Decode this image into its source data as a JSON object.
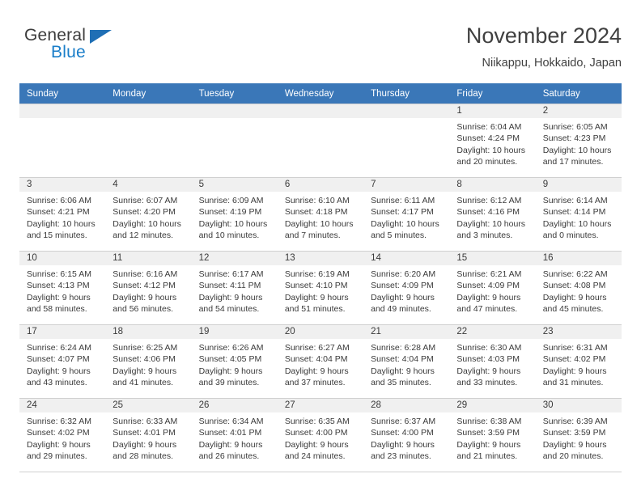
{
  "brand": {
    "name_part1": "General",
    "name_part2": "Blue",
    "triangle_color": "#1f6fb5",
    "blue_color": "#1a7ec9"
  },
  "header": {
    "month_title": "November 2024",
    "location": "Niikappu, Hokkaido, Japan"
  },
  "colors": {
    "header_blue": "#3a77b8",
    "daynum_band": "#f0f0f0",
    "cell_border": "#cfcfcf",
    "text": "#3a3a3a"
  },
  "weekdays": [
    "Sunday",
    "Monday",
    "Tuesday",
    "Wednesday",
    "Thursday",
    "Friday",
    "Saturday"
  ],
  "weeks": [
    [
      {
        "day": "",
        "sunrise": "",
        "sunset": "",
        "daylight": "",
        "blank": true
      },
      {
        "day": "",
        "sunrise": "",
        "sunset": "",
        "daylight": "",
        "blank": true
      },
      {
        "day": "",
        "sunrise": "",
        "sunset": "",
        "daylight": "",
        "blank": true
      },
      {
        "day": "",
        "sunrise": "",
        "sunset": "",
        "daylight": "",
        "blank": true
      },
      {
        "day": "",
        "sunrise": "",
        "sunset": "",
        "daylight": "",
        "blank": true
      },
      {
        "day": "1",
        "sunrise": "Sunrise: 6:04 AM",
        "sunset": "Sunset: 4:24 PM",
        "daylight": "Daylight: 10 hours and 20 minutes."
      },
      {
        "day": "2",
        "sunrise": "Sunrise: 6:05 AM",
        "sunset": "Sunset: 4:23 PM",
        "daylight": "Daylight: 10 hours and 17 minutes."
      }
    ],
    [
      {
        "day": "3",
        "sunrise": "Sunrise: 6:06 AM",
        "sunset": "Sunset: 4:21 PM",
        "daylight": "Daylight: 10 hours and 15 minutes."
      },
      {
        "day": "4",
        "sunrise": "Sunrise: 6:07 AM",
        "sunset": "Sunset: 4:20 PM",
        "daylight": "Daylight: 10 hours and 12 minutes."
      },
      {
        "day": "5",
        "sunrise": "Sunrise: 6:09 AM",
        "sunset": "Sunset: 4:19 PM",
        "daylight": "Daylight: 10 hours and 10 minutes."
      },
      {
        "day": "6",
        "sunrise": "Sunrise: 6:10 AM",
        "sunset": "Sunset: 4:18 PM",
        "daylight": "Daylight: 10 hours and 7 minutes."
      },
      {
        "day": "7",
        "sunrise": "Sunrise: 6:11 AM",
        "sunset": "Sunset: 4:17 PM",
        "daylight": "Daylight: 10 hours and 5 minutes."
      },
      {
        "day": "8",
        "sunrise": "Sunrise: 6:12 AM",
        "sunset": "Sunset: 4:16 PM",
        "daylight": "Daylight: 10 hours and 3 minutes."
      },
      {
        "day": "9",
        "sunrise": "Sunrise: 6:14 AM",
        "sunset": "Sunset: 4:14 PM",
        "daylight": "Daylight: 10 hours and 0 minutes."
      }
    ],
    [
      {
        "day": "10",
        "sunrise": "Sunrise: 6:15 AM",
        "sunset": "Sunset: 4:13 PM",
        "daylight": "Daylight: 9 hours and 58 minutes."
      },
      {
        "day": "11",
        "sunrise": "Sunrise: 6:16 AM",
        "sunset": "Sunset: 4:12 PM",
        "daylight": "Daylight: 9 hours and 56 minutes."
      },
      {
        "day": "12",
        "sunrise": "Sunrise: 6:17 AM",
        "sunset": "Sunset: 4:11 PM",
        "daylight": "Daylight: 9 hours and 54 minutes."
      },
      {
        "day": "13",
        "sunrise": "Sunrise: 6:19 AM",
        "sunset": "Sunset: 4:10 PM",
        "daylight": "Daylight: 9 hours and 51 minutes."
      },
      {
        "day": "14",
        "sunrise": "Sunrise: 6:20 AM",
        "sunset": "Sunset: 4:09 PM",
        "daylight": "Daylight: 9 hours and 49 minutes."
      },
      {
        "day": "15",
        "sunrise": "Sunrise: 6:21 AM",
        "sunset": "Sunset: 4:09 PM",
        "daylight": "Daylight: 9 hours and 47 minutes."
      },
      {
        "day": "16",
        "sunrise": "Sunrise: 6:22 AM",
        "sunset": "Sunset: 4:08 PM",
        "daylight": "Daylight: 9 hours and 45 minutes."
      }
    ],
    [
      {
        "day": "17",
        "sunrise": "Sunrise: 6:24 AM",
        "sunset": "Sunset: 4:07 PM",
        "daylight": "Daylight: 9 hours and 43 minutes."
      },
      {
        "day": "18",
        "sunrise": "Sunrise: 6:25 AM",
        "sunset": "Sunset: 4:06 PM",
        "daylight": "Daylight: 9 hours and 41 minutes."
      },
      {
        "day": "19",
        "sunrise": "Sunrise: 6:26 AM",
        "sunset": "Sunset: 4:05 PM",
        "daylight": "Daylight: 9 hours and 39 minutes."
      },
      {
        "day": "20",
        "sunrise": "Sunrise: 6:27 AM",
        "sunset": "Sunset: 4:04 PM",
        "daylight": "Daylight: 9 hours and 37 minutes."
      },
      {
        "day": "21",
        "sunrise": "Sunrise: 6:28 AM",
        "sunset": "Sunset: 4:04 PM",
        "daylight": "Daylight: 9 hours and 35 minutes."
      },
      {
        "day": "22",
        "sunrise": "Sunrise: 6:30 AM",
        "sunset": "Sunset: 4:03 PM",
        "daylight": "Daylight: 9 hours and 33 minutes."
      },
      {
        "day": "23",
        "sunrise": "Sunrise: 6:31 AM",
        "sunset": "Sunset: 4:02 PM",
        "daylight": "Daylight: 9 hours and 31 minutes."
      }
    ],
    [
      {
        "day": "24",
        "sunrise": "Sunrise: 6:32 AM",
        "sunset": "Sunset: 4:02 PM",
        "daylight": "Daylight: 9 hours and 29 minutes."
      },
      {
        "day": "25",
        "sunrise": "Sunrise: 6:33 AM",
        "sunset": "Sunset: 4:01 PM",
        "daylight": "Daylight: 9 hours and 28 minutes."
      },
      {
        "day": "26",
        "sunrise": "Sunrise: 6:34 AM",
        "sunset": "Sunset: 4:01 PM",
        "daylight": "Daylight: 9 hours and 26 minutes."
      },
      {
        "day": "27",
        "sunrise": "Sunrise: 6:35 AM",
        "sunset": "Sunset: 4:00 PM",
        "daylight": "Daylight: 9 hours and 24 minutes."
      },
      {
        "day": "28",
        "sunrise": "Sunrise: 6:37 AM",
        "sunset": "Sunset: 4:00 PM",
        "daylight": "Daylight: 9 hours and 23 minutes."
      },
      {
        "day": "29",
        "sunrise": "Sunrise: 6:38 AM",
        "sunset": "Sunset: 3:59 PM",
        "daylight": "Daylight: 9 hours and 21 minutes."
      },
      {
        "day": "30",
        "sunrise": "Sunrise: 6:39 AM",
        "sunset": "Sunset: 3:59 PM",
        "daylight": "Daylight: 9 hours and 20 minutes."
      }
    ]
  ]
}
